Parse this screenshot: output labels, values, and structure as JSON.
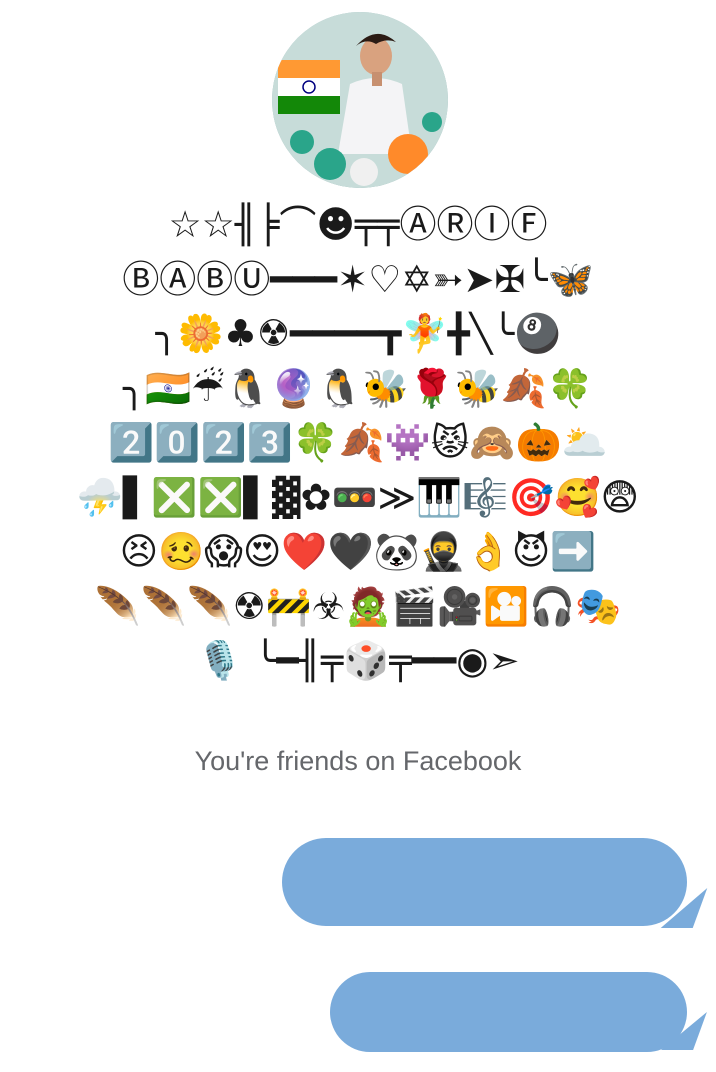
{
  "profile": {
    "avatar_icon": "profile-photo",
    "name_lines": [
      "☆☆╢╞⌒☻╤╤ⒶⓇⒾⒻ",
      "ⒷⒶⒷⓊ━━━✶♡✡➳➤✠╰🦋",
      "╮🌼♣☢━━━━┳🧚╋╲╰🎱",
      "╮🇮🇳☔🐧🔮🐧🐝🌹🐝🍂🍀",
      "2️⃣0️⃣2️⃣3️⃣🍀🍂👾😾🙈🎃🌥️",
      "⛈️▌❎❎▌▓✿🚥≫🎹🎼🎯🥰😨",
      "😣🥴😱😍❤️🖤🐼🥷👌😈➡️",
      "🪶🪶🪶☢🚧☣🧟🎬🎥🎦🎧🎭",
      "🎙️ ╰━╢╤🎲╤━━◉➣"
    ]
  },
  "status": {
    "friends_text": "You're friends on Facebook"
  },
  "messages": [
    {
      "text": "",
      "side": "outgoing"
    },
    {
      "text": "",
      "side": "outgoing"
    }
  ],
  "colors": {
    "bubble": "#7aabdb",
    "secondary_text": "#65676b"
  }
}
